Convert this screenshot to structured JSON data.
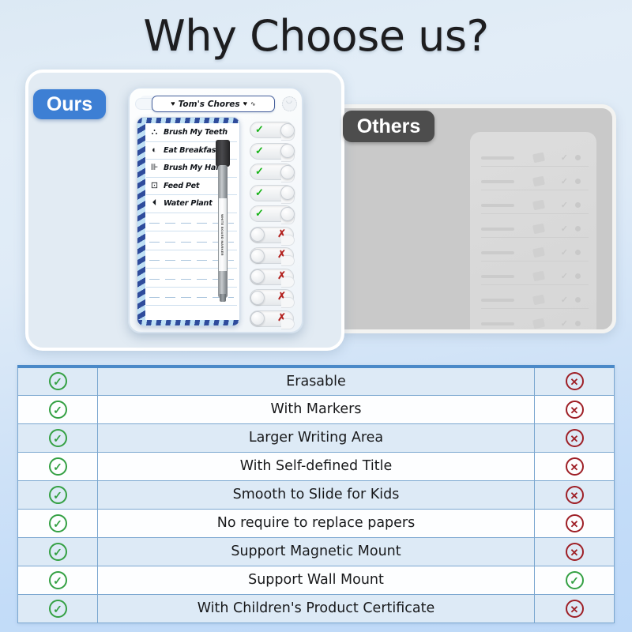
{
  "header": {
    "title": "Why Choose us?"
  },
  "badges": {
    "ours": "Ours",
    "others": "Others"
  },
  "product": {
    "board_title": "Tom's Chores",
    "heart_left": "♥",
    "heart_right": "♥",
    "wave": "∿",
    "marker_label": "WHITE BOARD MARKER",
    "chores": [
      {
        "icon": "tooth-icon",
        "glyph": "⛬",
        "label": "Brush My Teeth",
        "state": "done"
      },
      {
        "icon": "bread-icon",
        "glyph": "◐",
        "label": "Eat Breakfast",
        "state": "done"
      },
      {
        "icon": "comb-icon",
        "glyph": "⊪",
        "label": "Brush My Hair",
        "state": "done"
      },
      {
        "icon": "pet-face-icon",
        "glyph": "⊡",
        "label": "Feed Pet",
        "state": "done"
      },
      {
        "icon": "watering-can-icon",
        "glyph": "⏴",
        "label": "Water Plant",
        "state": "done"
      },
      {
        "icon": "",
        "glyph": "",
        "label": "",
        "state": "empty"
      },
      {
        "icon": "",
        "glyph": "",
        "label": "",
        "state": "empty"
      },
      {
        "icon": "",
        "glyph": "",
        "label": "",
        "state": "empty"
      },
      {
        "icon": "",
        "glyph": "",
        "label": "",
        "state": "empty"
      },
      {
        "icon": "",
        "glyph": "",
        "label": "",
        "state": "empty"
      }
    ],
    "slider_states": [
      "done",
      "done",
      "done",
      "done",
      "done",
      "empty",
      "empty",
      "empty",
      "empty",
      "empty"
    ],
    "mark_done": "✓",
    "mark_empty": "✗"
  },
  "comparison": {
    "yes_glyph": "✓",
    "no_glyph": "✕",
    "rows": [
      {
        "feature": "Erasable",
        "ours": "yes",
        "others": "no"
      },
      {
        "feature": "With Markers",
        "ours": "yes",
        "others": "no"
      },
      {
        "feature": "Larger Writing Area",
        "ours": "yes",
        "others": "no"
      },
      {
        "feature": "With Self-defined Title",
        "ours": "yes",
        "others": "no"
      },
      {
        "feature": "Smooth to Slide for Kids",
        "ours": "yes",
        "others": "no"
      },
      {
        "feature": "No require to replace papers",
        "ours": "yes",
        "others": "no"
      },
      {
        "feature": "Support Magnetic Mount",
        "ours": "yes",
        "others": "no"
      },
      {
        "feature": "Support Wall Mount",
        "ours": "yes",
        "others": "yes"
      },
      {
        "feature": "With Children's Product Certificate",
        "ours": "yes",
        "others": "no"
      }
    ]
  },
  "colors": {
    "accent_blue": "#3d7fd4",
    "badge_dark": "#4d4d4d",
    "green": "#34a043",
    "red": "#9e1f26",
    "table_border": "#7ba7d0",
    "row_alt": "#ddeaf6"
  }
}
